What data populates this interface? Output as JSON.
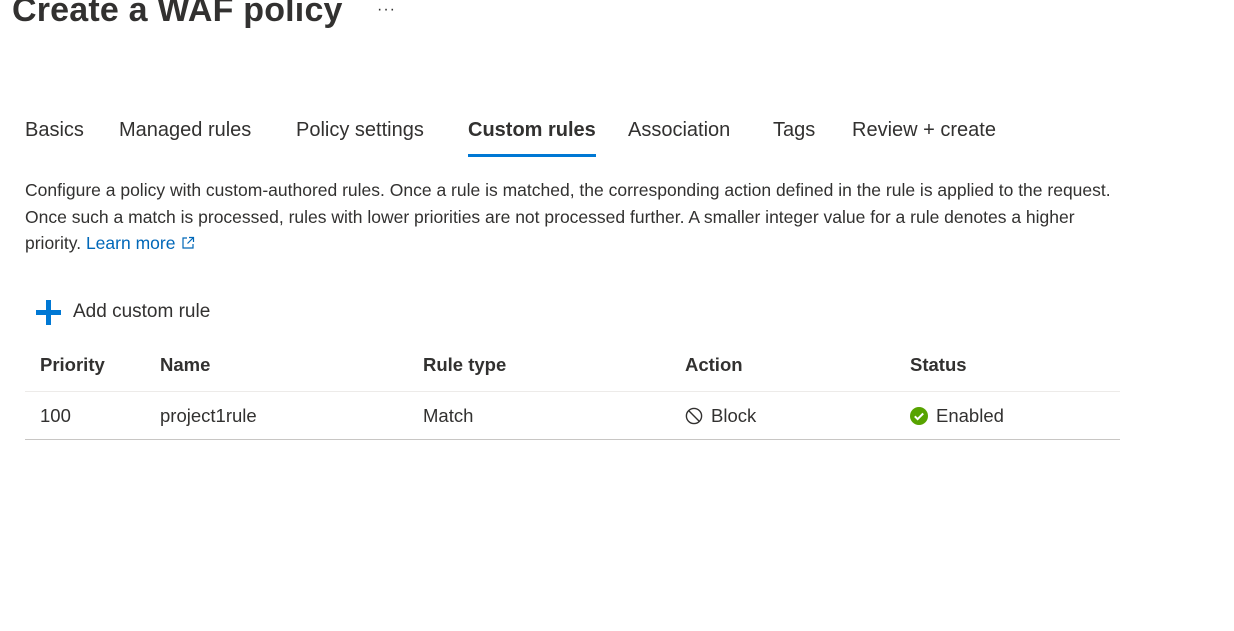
{
  "header": {
    "title": "Create a WAF policy",
    "more_label": "···"
  },
  "tabs": [
    {
      "label": "Basics",
      "active": false
    },
    {
      "label": "Managed rules",
      "active": false
    },
    {
      "label": "Policy settings",
      "active": false
    },
    {
      "label": "Custom rules",
      "active": true
    },
    {
      "label": "Association",
      "active": false
    },
    {
      "label": "Tags",
      "active": false
    },
    {
      "label": "Review + create",
      "active": false
    }
  ],
  "description": {
    "text": "Configure a policy with custom-authored rules. Once a rule is matched, the corresponding action defined in the rule is applied to the request. Once such a match is processed, rules with lower priorities are not processed further. A smaller integer value for a rule denotes a higher priority.",
    "link_label": "Learn more",
    "link_icon": "external-link-icon"
  },
  "toolbar": {
    "add_label": "Add custom rule",
    "add_icon": "plus-icon"
  },
  "table": {
    "columns": [
      "Priority",
      "Name",
      "Rule type",
      "Action",
      "Status"
    ],
    "rows": [
      {
        "priority": "100",
        "name": "project1rule",
        "rule_type": "Match",
        "action": "Block",
        "action_icon": "block-icon",
        "status": "Enabled",
        "status_icon": "check-circle-icon"
      }
    ]
  },
  "colors": {
    "accent": "#0078d4",
    "link": "#0067b8",
    "success": "#57a300",
    "text": "#323130"
  }
}
